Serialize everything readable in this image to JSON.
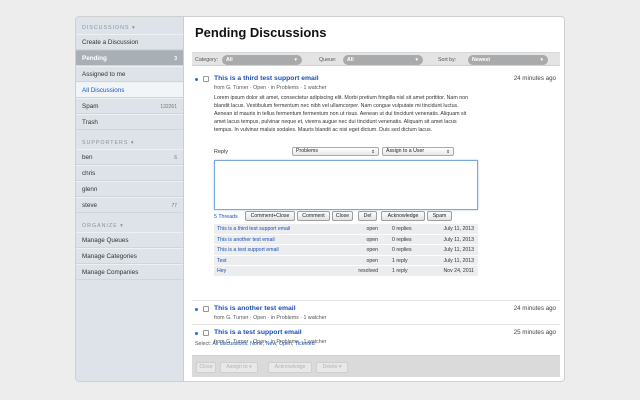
{
  "sidebar": {
    "sections": {
      "discussions": "DISCUSSIONS ▾",
      "supporters": "SUPPORTERS ▾",
      "organize": "ORGANIZE ▾"
    },
    "discussion_items": [
      {
        "label": "Create a Discussion",
        "count": ""
      },
      {
        "label": "Pending",
        "count": "3"
      },
      {
        "label": "Assigned to me",
        "count": ""
      },
      {
        "label": "All Discussions",
        "count": ""
      },
      {
        "label": "Spam",
        "count": "132261"
      },
      {
        "label": "Trash",
        "count": ""
      }
    ],
    "supporter_items": [
      {
        "label": "ben",
        "count": "6"
      },
      {
        "label": "chris",
        "count": ""
      },
      {
        "label": "glenn",
        "count": ""
      },
      {
        "label": "steve",
        "count": "77"
      }
    ],
    "organize_items": [
      {
        "label": "Manage Queues"
      },
      {
        "label": "Manage Categories"
      },
      {
        "label": "Manage Companies"
      }
    ]
  },
  "main": {
    "title": "Pending Discussions",
    "filters": {
      "category_label": "Category:",
      "category_value": "All",
      "queue_label": "Queue:",
      "queue_value": "All",
      "sort_label": "Sort by:",
      "sort_value": "Newest"
    },
    "threads": [
      {
        "title": "This is a third test support email",
        "time": "24 minutes ago",
        "meta": "from G. Turner  ·  Open  ·  in Problems  ·  1 watcher",
        "body": "Lorem ipsum dolor sit amet, consectetur adipiscing elit. Morbi pretium fringilla nisl sit amet porttitor. Nam non blandit lacus. Vestibulum fermentum nec nibh vel ullamcorper. Nam congue vulputate mi tincidunt luctus. Aenean id mauris in tellus fermentum fermentum non ut risus. Aenean ut dui tincidunt venenatis. Aliquam sit amet lacus tempus, pulvinar neque et, viverra augue nec dui tincidunt venenatis. Aliquam sit amet lacus tempus. In vulvinar maluis sodales. Mauris blandit ac nisi eget dictum. Duis sed dictum lacus."
      },
      {
        "title": "This is another test email",
        "time": "24 minutes ago",
        "meta": "from G. Turner  ·  Open  ·  in Problems  ·  1 watcher"
      },
      {
        "title": "This is a test support email",
        "time": "25 minutes ago",
        "meta": "from G. Turner  ·  Open  ·  in Problems  ·  1 watcher"
      }
    ],
    "reply": {
      "label": "Reply",
      "category_select": "Problems",
      "assign_select": "Assign to a User",
      "textarea_value": "",
      "threads_link": "5 Threads",
      "buttons": [
        "Comment+Close",
        "Comment",
        "Close",
        "Del",
        "Acknowledge",
        "Spam"
      ]
    },
    "related": [
      {
        "title": "This is a third test support email",
        "status": "open",
        "replies": "0 replies",
        "date": "July 11, 2013"
      },
      {
        "title": "This is another test email",
        "status": "open",
        "replies": "0 replies",
        "date": "July 11, 2013"
      },
      {
        "title": "This is a test support email",
        "status": "open",
        "replies": "0 replies",
        "date": "July 11, 2013"
      },
      {
        "title": "Test",
        "status": "open",
        "replies": "1 reply",
        "date": "July 11, 2013"
      },
      {
        "title": "Hey",
        "status": "resolved",
        "replies": "1 reply",
        "date": "Nov 24, 2011"
      }
    ],
    "select_line": {
      "prefix": "Select:",
      "links": [
        "All discussions",
        "None",
        "New",
        "Open",
        "Ticketed"
      ]
    },
    "bulk_actions": [
      "Close",
      "Assign to ▾",
      "Acknowledge",
      "Delete ▾"
    ]
  },
  "colors": {
    "accent": "#1a4eb5",
    "unread_dot": "#2a6fd6",
    "sidebar_bg": "#dde3e8",
    "active_item": "#a9b0b5"
  }
}
